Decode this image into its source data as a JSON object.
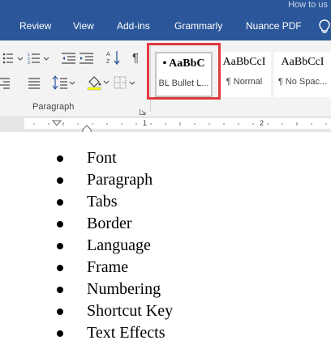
{
  "window": {
    "title_partial": "How to us"
  },
  "ribbon_tabs": [
    {
      "label": "Review"
    },
    {
      "label": "View"
    },
    {
      "label": "Add-ins"
    },
    {
      "label": "Grammarly"
    },
    {
      "label": "Nuance PDF"
    }
  ],
  "tell_me_icon": "lightbulb-icon",
  "paragraph_group": {
    "label": "Paragraph",
    "buttons": [
      "bullets-icon",
      "numbering-icon",
      "decrease-indent-icon",
      "increase-indent-icon",
      "sort-icon",
      "show-marks-icon",
      "align-right-icon",
      "justify-icon",
      "line-spacing-icon",
      "shading-icon",
      "borders-icon"
    ]
  },
  "styles": [
    {
      "sample": "• AaBbC",
      "name": "BL Bullet L...",
      "selected": true
    },
    {
      "sample": "AaBbCcI",
      "name": "¶ Normal",
      "selected": false
    },
    {
      "sample": "AaBbCcI",
      "name": "¶ No Spac...",
      "selected": false
    }
  ],
  "ruler": {
    "marks": [
      "1",
      "2"
    ]
  },
  "document": {
    "bullets": [
      "Font",
      "Paragraph",
      "Tabs",
      "Border",
      "Language",
      "Frame",
      "Numbering",
      "Shortcut Key",
      "Text Effects"
    ]
  },
  "colors": {
    "ribbon_blue": "#2b579a",
    "highlight": "#e0393e"
  }
}
